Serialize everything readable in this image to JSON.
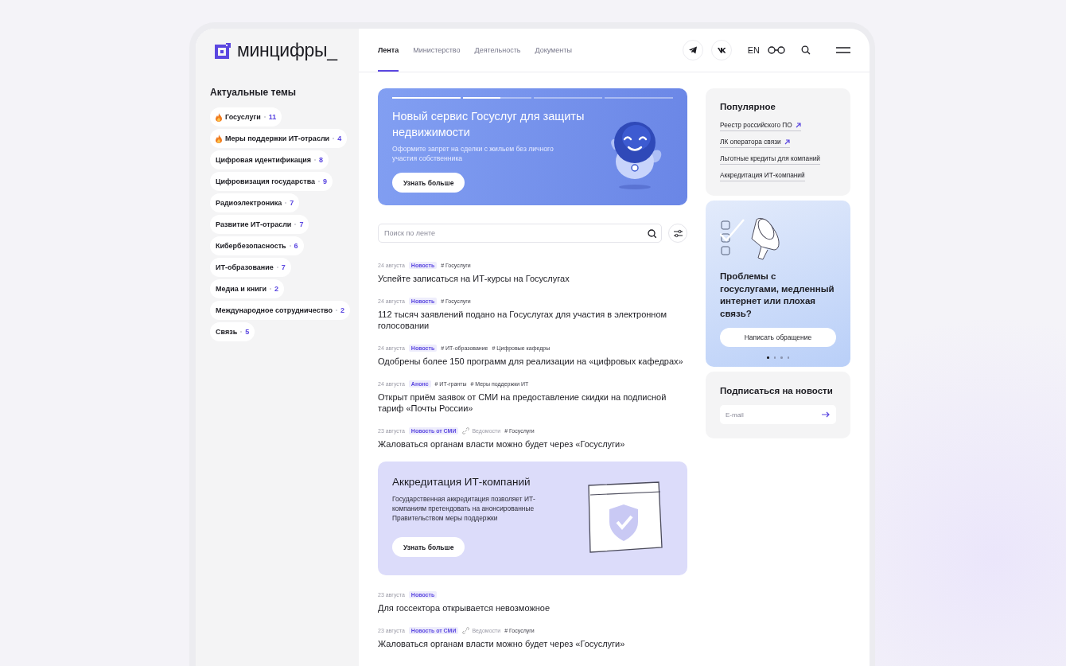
{
  "logo": {
    "text": "минцифры_"
  },
  "nav": {
    "tabs": [
      {
        "label": "Лента",
        "selected": true
      },
      {
        "label": "Министерство",
        "selected": false
      },
      {
        "label": "Деятельность",
        "selected": false
      },
      {
        "label": "Документы",
        "selected": false
      }
    ],
    "language": "EN"
  },
  "topics": {
    "title": "Актуальные темы",
    "items": [
      {
        "label": "Госуслуги",
        "count": "11",
        "hot": true
      },
      {
        "label": "Меры поддержки ИТ-отрасли",
        "count": "4",
        "hot": true
      },
      {
        "label": "Цифровая идентификация",
        "count": "8",
        "hot": false
      },
      {
        "label": "Цифровизация государства",
        "count": "9",
        "hot": false
      },
      {
        "label": "Радиоэлектроника",
        "count": "7",
        "hot": false
      },
      {
        "label": "Развитие ИТ-отрасли",
        "count": "7",
        "hot": false
      },
      {
        "label": "Кибербезопасность",
        "count": "6",
        "hot": false
      },
      {
        "label": "ИТ-образование",
        "count": "7",
        "hot": false
      },
      {
        "label": "Медиа и книги",
        "count": "2",
        "hot": false
      },
      {
        "label": "Международное сотрудничество",
        "count": "2",
        "hot": false
      },
      {
        "label": "Связь",
        "count": "5",
        "hot": false
      }
    ]
  },
  "banner": {
    "title": "Новый сервис Госуслуг для защиты недвижимости",
    "text": "Оформите запрет на сделки с жильем без личного участия собственника",
    "button": "Узнать больше",
    "progress": [
      {
        "level": 1
      },
      {
        "level": 0.55
      },
      {
        "level": 0
      },
      {
        "level": 0
      }
    ]
  },
  "search": {
    "placeholder": "Поиск по ленте"
  },
  "feed": [
    {
      "kind": "news",
      "date": "24 августа",
      "type": "Новость",
      "tags": [
        "# Госуслуги"
      ],
      "title": "Успейте записаться на ИТ-курсы на Госуслугах"
    },
    {
      "kind": "news",
      "date": "24 августа",
      "type": "Новость",
      "tags": [
        "# Госуслуги"
      ],
      "title": "112 тысяч заявлений подано на Госуслугах для участия в электронном голосовании"
    },
    {
      "kind": "news",
      "date": "24 августа",
      "type": "Новость",
      "tags": [
        "# ИТ-образование",
        "# Цифровые кафедры"
      ],
      "title": "Одобрены более 150 программ для реализации на «цифровых кафедрах»"
    },
    {
      "kind": "news",
      "date": "24 августа",
      "type": "Анонс",
      "tags": [
        "# ИТ-гранты",
        "# Меры поддержки ИТ"
      ],
      "title": "Открыт приём заявок от СМИ на предоставление скидки на подписной тариф «Почты России»"
    },
    {
      "kind": "news",
      "date": "23 августа",
      "type": "Новость от СМИ",
      "source": "Ведомости",
      "tags": [
        "# Госуслуги"
      ],
      "title": "Жаловаться органам власти можно будет через «Госуслуги»"
    },
    {
      "kind": "promo",
      "title": "Аккредитация ИТ-компаний",
      "text": "Государственная аккредитация позволяет ИТ-компаниям претендовать на анонсированные Правительством меры поддержки",
      "button": "Узнать больше"
    },
    {
      "kind": "news",
      "date": "23 августа",
      "type": "Новость",
      "title": "Для госсектора открывается невозможное"
    },
    {
      "kind": "news",
      "date": "23 августа",
      "type": "Новость от СМИ",
      "source": "Ведомости",
      "tags": [
        "# Госуслуги"
      ],
      "title": "Жаловаться органам власти можно будет через «Госуслуги»"
    }
  ],
  "popular": {
    "title": "Популярное",
    "links": [
      {
        "label": "Реестр российского ПО",
        "external": true
      },
      {
        "label": "ЛК оператора связи",
        "external": true
      },
      {
        "label": "Льготные кредиты для компаний",
        "external": false
      },
      {
        "label": "Аккредитация ИТ-компаний",
        "external": false
      }
    ]
  },
  "appeal": {
    "title": "Проблемы с госуслугами, медленный интернет или плохая связь?",
    "button": "Написать обращение",
    "dots": [
      {
        "selected": true
      },
      {
        "selected": false
      },
      {
        "selected": false
      },
      {
        "selected": false
      }
    ]
  },
  "subscribe": {
    "title": "Подписаться на новости",
    "placeholder": "E-mail"
  }
}
